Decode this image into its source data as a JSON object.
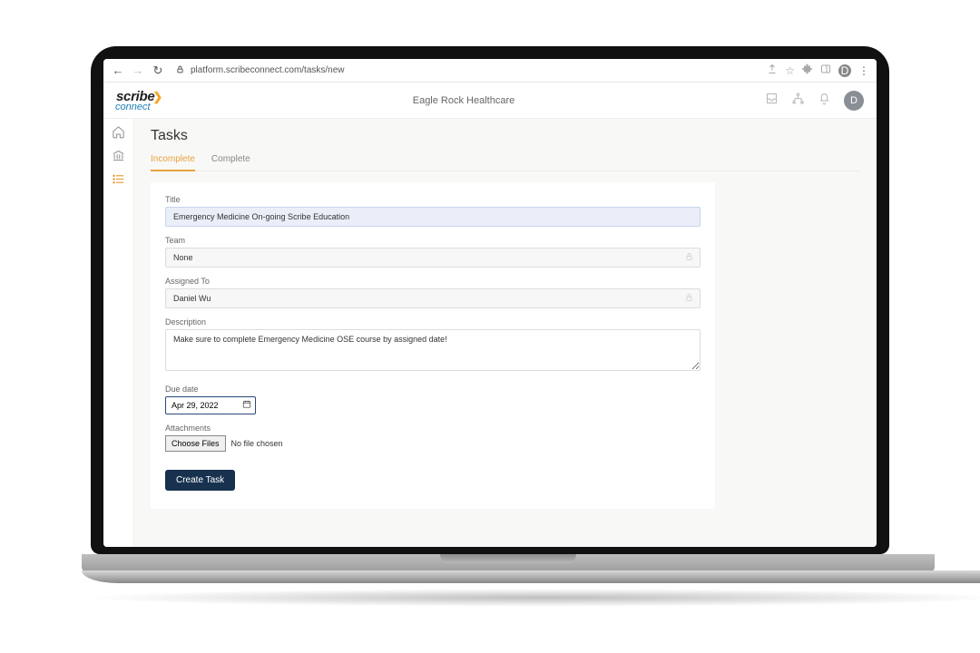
{
  "browser": {
    "url": "platform.scribeconnect.com/tasks/new",
    "ext_initial": "D"
  },
  "app": {
    "logo_main": "scribe",
    "logo_sub": "connect",
    "org_name": "Eagle Rock Healthcare",
    "avatar_initial": "D"
  },
  "page": {
    "title": "Tasks",
    "tabs": {
      "incomplete": "Incomplete",
      "complete": "Complete"
    }
  },
  "form": {
    "title_label": "Title",
    "title_value": "Emergency Medicine On-going Scribe Education",
    "team_label": "Team",
    "team_value": "None",
    "assigned_label": "Assigned To",
    "assigned_value": "Daniel Wu",
    "desc_label": "Description",
    "desc_value": "Make sure to complete Emergency Medicine OSE course by assigned date!",
    "duedate_label": "Due date",
    "duedate_value": "Apr 29, 2022",
    "attach_label": "Attachments",
    "choose_files": "Choose Files",
    "no_file": "No file chosen",
    "submit": "Create Task"
  }
}
